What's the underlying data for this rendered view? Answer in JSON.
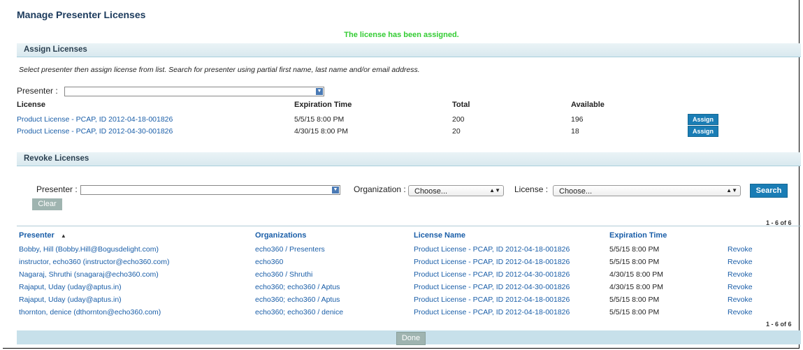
{
  "page": {
    "title": "Manage Presenter Licenses",
    "message": "The license has been assigned.",
    "done_label": "Done"
  },
  "assign": {
    "section_title": "Assign Licenses",
    "instructions": "Select presenter then assign license from list. Search for presenter using partial first name, last name and/or email address.",
    "presenter_label": "Presenter :",
    "presenter_value": "",
    "columns": [
      "License",
      "Expiration Time",
      "Total",
      "Available"
    ],
    "rows": [
      {
        "license": "Product License - PCAP, ID 2012-04-18-001826",
        "expiration": "5/5/15 8:00 PM",
        "total": "200",
        "available": "196",
        "action": "Assign"
      },
      {
        "license": "Product License - PCAP, ID 2012-04-30-001826",
        "expiration": "4/30/15 8:00 PM",
        "total": "20",
        "available": "18",
        "action": "Assign"
      }
    ]
  },
  "revoke": {
    "section_title": "Revoke Licenses",
    "presenter_label": "Presenter :",
    "organization_label": "Organization :",
    "organization_value": "Choose...",
    "license_label": "License :",
    "license_value": "Choose...",
    "search_label": "Search",
    "clear_label": "Clear",
    "count_top": "1 - 6  of  6",
    "count_bottom": "1 - 6  of  6",
    "columns": [
      "Presenter",
      "Organizations",
      "License Name",
      "Expiration Time"
    ],
    "sort_indicator": "▲",
    "rows": [
      {
        "presenter": "Bobby, Hill (Bobby.Hill@Bogusdelight.com)",
        "org": "echo360 / Presenters",
        "license": "Product License - PCAP, ID 2012-04-18-001826",
        "expiration": "5/5/15 8:00 PM",
        "action": "Revoke"
      },
      {
        "presenter": "instructor, echo360 (instructor@echo360.com)",
        "org": "echo360",
        "license": "Product License - PCAP, ID 2012-04-18-001826",
        "expiration": "5/5/15 8:00 PM",
        "action": "Revoke"
      },
      {
        "presenter": "Nagaraj, Shruthi (snagaraj@echo360.com)",
        "org": "echo360 / Shruthi",
        "license": "Product License - PCAP, ID 2012-04-30-001826",
        "expiration": "4/30/15 8:00 PM",
        "action": "Revoke"
      },
      {
        "presenter": "Rajaput, Uday (uday@aptus.in)",
        "org": "echo360; echo360 / Aptus",
        "license": "Product License - PCAP, ID 2012-04-30-001826",
        "expiration": "4/30/15 8:00 PM",
        "action": "Revoke"
      },
      {
        "presenter": "Rajaput, Uday (uday@aptus.in)",
        "org": "echo360; echo360 / Aptus",
        "license": "Product License - PCAP, ID 2012-04-18-001826",
        "expiration": "5/5/15 8:00 PM",
        "action": "Revoke"
      },
      {
        "presenter": "thornton, denice (dthornton@echo360.com)",
        "org": "echo360; echo360 / denice",
        "license": "Product License - PCAP, ID 2012-04-18-001826",
        "expiration": "5/5/15 8:00 PM",
        "action": "Revoke"
      }
    ]
  }
}
